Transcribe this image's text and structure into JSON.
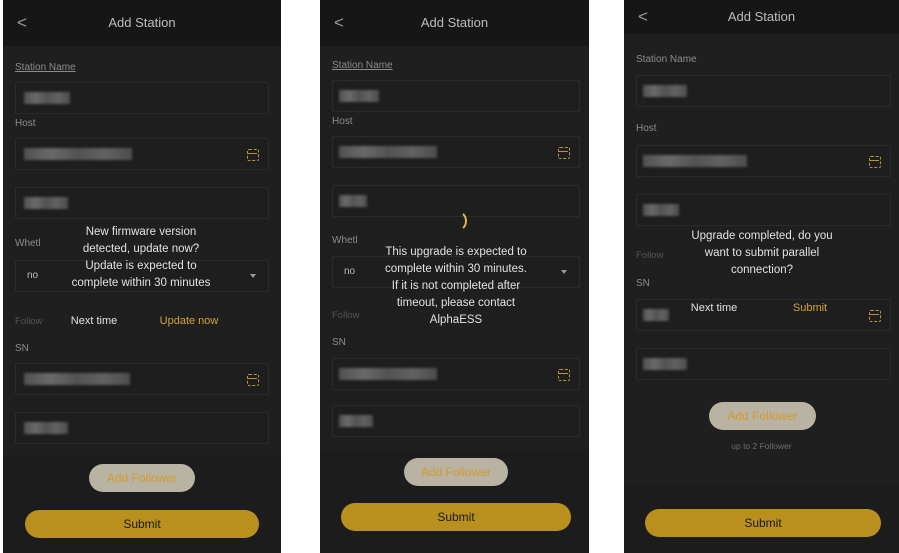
{
  "common": {
    "back_glyph": "<",
    "title": "Add Station",
    "station_name_label": "Station Name",
    "host_label": "Host",
    "whether_label": "Whetl",
    "follower_label": "Follow",
    "sn_label": "SN",
    "add_follower_label": "Add Follower",
    "submit_label": "Submit",
    "no_value": "no"
  },
  "screen1": {
    "dialog_message": [
      "New firmware version",
      "detected, update now?",
      "Update is expected to",
      "complete within 30 minutes"
    ],
    "next_time_label": "Next time",
    "update_now_label": "Update now"
  },
  "screen2": {
    "dialog_message": [
      "This upgrade is expected to",
      "complete within 30 minutes.",
      "If it is not completed after",
      "timeout, please contact",
      "AlphaESS"
    ]
  },
  "screen3": {
    "dialog_message": [
      "Upgrade completed, do you",
      "want to submit parallel",
      "connection?"
    ],
    "next_time_label": "Next time",
    "submit_dialog_label": "Submit",
    "follower_limit_hint": "up to 2 Follower"
  },
  "colors": {
    "accent": "#d4a237",
    "submit_bg": "#b9901e",
    "background": "#1c1c1c"
  },
  "icons": [
    "chevron-left-icon",
    "scan-icon",
    "dropdown-icon",
    "spinner-icon"
  ]
}
